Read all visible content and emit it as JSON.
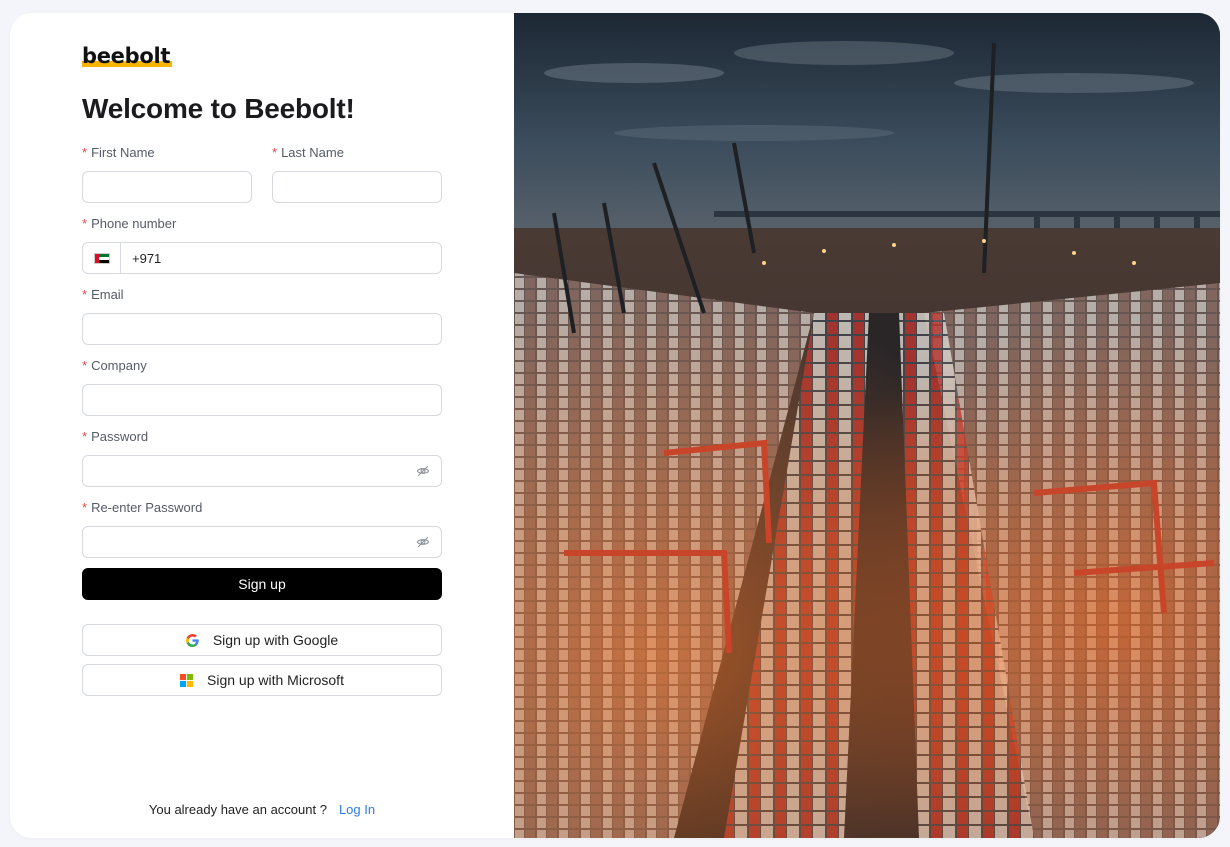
{
  "brand": {
    "logo_text": "beebolt",
    "accent_color": "#f7b500"
  },
  "title": "Welcome to Beebolt!",
  "form": {
    "required_mark": "*",
    "first_name": {
      "label": "First Name",
      "value": ""
    },
    "last_name": {
      "label": "Last Name",
      "value": ""
    },
    "phone": {
      "label": "Phone number",
      "country": "AE",
      "flag_icon": "uae-flag-icon",
      "value": "+971"
    },
    "email": {
      "label": "Email",
      "value": ""
    },
    "company": {
      "label": "Company",
      "value": ""
    },
    "password": {
      "label": "Password",
      "value": "",
      "toggle_icon": "eye-off-icon"
    },
    "confirm_password": {
      "label": "Re-enter Password",
      "value": "",
      "toggle_icon": "eye-off-icon"
    },
    "submit_label": "Sign up"
  },
  "social": {
    "google_label": "Sign up with Google",
    "microsoft_label": "Sign up with Microsoft"
  },
  "footer": {
    "prompt": "You already have an account ?",
    "login_link": "Log In"
  },
  "colors": {
    "primary_button": "#000000",
    "link": "#2f7be5",
    "required": "#e5484d"
  }
}
